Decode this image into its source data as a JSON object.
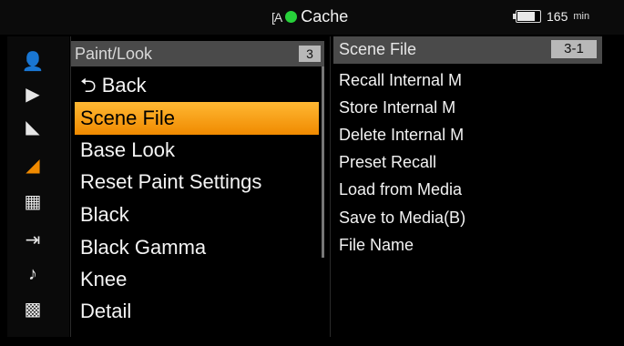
{
  "status": {
    "media_icon": "media-card-icon",
    "mode_glyph": "[A",
    "cache_label": "Cache",
    "battery_minutes": "165",
    "battery_unit": "min",
    "battery_level": 0.85
  },
  "sidebar": {
    "icons": [
      {
        "name": "user-menu-icon",
        "glyph": "👤",
        "active": false
      },
      {
        "name": "camera-icon",
        "glyph": "▶",
        "active": false
      },
      {
        "name": "clapper-icon",
        "glyph": "◣",
        "active": false
      },
      {
        "name": "paint-look-icon",
        "glyph": "◢",
        "active": true
      },
      {
        "name": "timecode-icon",
        "glyph": "▦",
        "active": false
      },
      {
        "name": "output-icon",
        "glyph": "⇥",
        "active": false
      },
      {
        "name": "audio-icon",
        "glyph": "♪",
        "active": false
      },
      {
        "name": "checker-icon",
        "glyph": "▩",
        "active": false
      }
    ]
  },
  "menu": {
    "title": "Paint/Look",
    "number": "3",
    "items": [
      {
        "label": "⮌ Back",
        "selected": false
      },
      {
        "label": "Scene File",
        "selected": true
      },
      {
        "label": "Base Look",
        "selected": false
      },
      {
        "label": "Reset Paint Settings",
        "selected": false
      },
      {
        "label": "Black",
        "selected": false
      },
      {
        "label": "Black Gamma",
        "selected": false
      },
      {
        "label": "Knee",
        "selected": false
      },
      {
        "label": "Detail",
        "selected": false
      }
    ]
  },
  "submenu": {
    "title": "Scene File",
    "number": "3-1",
    "items": [
      "Recall Internal M",
      "Store Internal M",
      "Delete Internal M",
      "Preset Recall",
      "Load from Media",
      "Save to Media(B)",
      "File Name"
    ]
  },
  "colors": {
    "accent": "#f08a00",
    "highlight": "#ffb833",
    "status_green": "#27d13a"
  }
}
